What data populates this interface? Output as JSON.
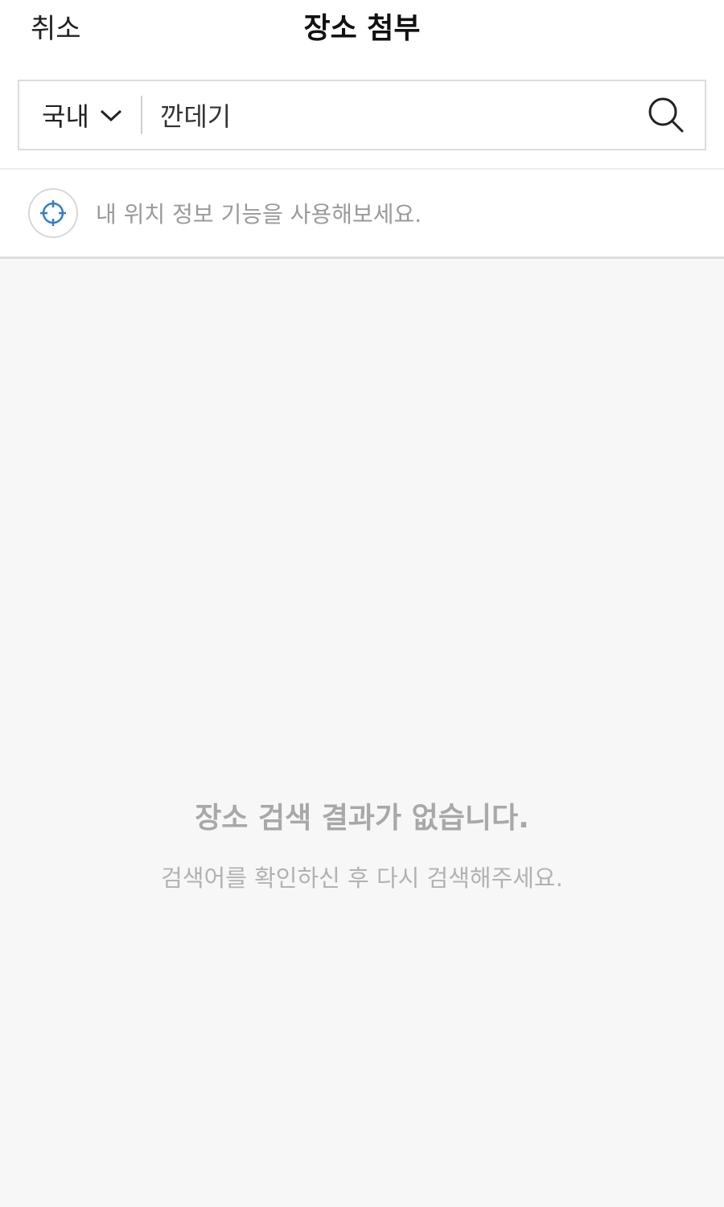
{
  "header": {
    "cancel_label": "취소",
    "title": "장소 첨부"
  },
  "search": {
    "region": "국내",
    "query": "깐데기",
    "search_icon": "search-icon",
    "chevron_icon": "chevron-down-icon"
  },
  "location": {
    "icon": "crosshair-icon",
    "text": "내 위치 정보 기능을 사용해보세요.",
    "accent_color": "#2f7fc6"
  },
  "empty_state": {
    "title": "장소 검색 결과가 없습니다.",
    "subtitle": "검색어를 확인하신 후 다시 검색해주세요."
  }
}
